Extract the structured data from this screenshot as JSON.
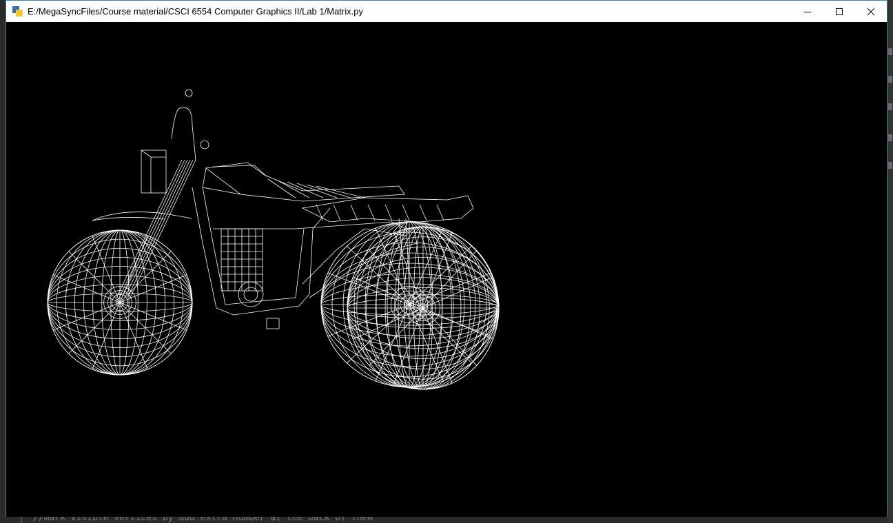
{
  "window": {
    "title": "E:/MegaSyncFiles/Course material/CSCI 6554 Computer Graphics II/Lab 1/Matrix.py",
    "controls": {
      "minimize": "minimize",
      "maximize": "maximize",
      "close": "close"
    }
  },
  "viewport": {
    "model": "motorcycle-wireframe",
    "line_color": "#ffffff",
    "background": "#000000"
  },
  "background_editor": {
    "code_line": "//mark visible vertices by add extra number at the back of them"
  }
}
